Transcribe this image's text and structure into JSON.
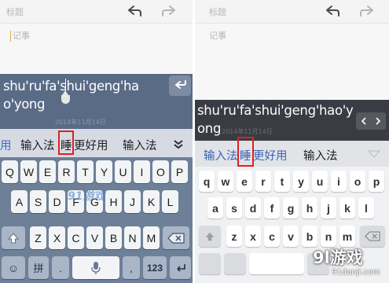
{
  "left": {
    "title_placeholder": "标题",
    "body_placeholder": "记事",
    "composition_line1": "shu'ru'fa'shui'geng'ha",
    "composition_line2": "o'yong",
    "ghost_date": "2014年11月14日",
    "candidates": [
      "用",
      "输入法",
      "睡",
      "更好用",
      "输入法"
    ],
    "keys_row1": [
      "Q",
      "W",
      "E",
      "R",
      "T",
      "Y",
      "U",
      "I",
      "O",
      "P"
    ],
    "keys_row2": [
      "A",
      "S",
      "D",
      "F",
      "G",
      "H",
      "J",
      "K",
      "L"
    ],
    "keys_row3": [
      "Z",
      "X",
      "C",
      "V",
      "B",
      "N",
      "M"
    ],
    "bottom_pinyin": "拼",
    "bottom_dot": ".",
    "bottom_123": "123",
    "bottom_sym": "☺",
    "watermark": "91游戏"
  },
  "right": {
    "title_placeholder": "标题",
    "body_placeholder": "记事",
    "composition_line1": "shu'ru'fa'shui'geng'hao'y",
    "composition_line2": "ong",
    "ghost_date": "2014年11月14日",
    "candidates": [
      "输入法",
      "睡",
      "更好用",
      "输入法"
    ],
    "keys_row1": [
      "q",
      "w",
      "e",
      "r",
      "t",
      "y",
      "u",
      "i",
      "o",
      "p"
    ],
    "keys_row2": [
      "a",
      "s",
      "d",
      "f",
      "g",
      "h",
      "j",
      "k",
      "l"
    ],
    "keys_row3": [
      "z",
      "x",
      "c",
      "v",
      "b",
      "n",
      "m"
    ]
  },
  "logo": {
    "main": "9l游戏",
    "sub": "91danji.com"
  },
  "icons": {
    "undo": "undo-icon",
    "redo": "redo-icon",
    "backspace": "backspace-icon",
    "shift": "shift-icon",
    "microphone": "microphone-icon",
    "collapse": "chevron-down-icon"
  },
  "colors": {
    "highlight_box": "#e02020",
    "left_keyboard_bg": "#6d8098",
    "right_composition_bg": "#3a3c44"
  }
}
